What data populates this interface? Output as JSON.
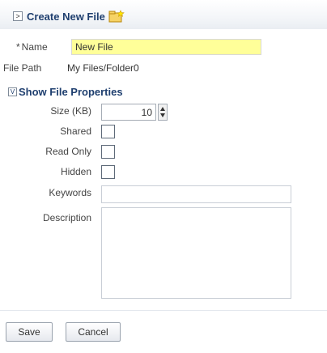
{
  "dialog": {
    "title": "Create New File",
    "toggle_glyph": ">"
  },
  "name_field": {
    "required_marker": "*",
    "label": "Name",
    "value": "New File"
  },
  "file_path": {
    "label": "File Path",
    "value": "My Files/Folder0"
  },
  "properties": {
    "toggle_glyph": "V",
    "title": "Show File Properties",
    "size": {
      "label": "Size (KB)",
      "value": "10"
    },
    "shared": {
      "label": "Shared",
      "checked": false
    },
    "read_only": {
      "label": "Read Only",
      "checked": false
    },
    "hidden": {
      "label": "Hidden",
      "checked": false
    },
    "keywords": {
      "label": "Keywords",
      "value": ""
    },
    "description": {
      "label": "Description",
      "value": ""
    }
  },
  "buttons": {
    "save": "Save",
    "cancel": "Cancel"
  },
  "colors": {
    "name_input_bg": "#ffff99",
    "title_color": "#1f3f6f"
  },
  "icons": {
    "header_toggle": "expand-icon",
    "file": "new-file-icon",
    "properties_toggle": "disclosure-icon"
  }
}
